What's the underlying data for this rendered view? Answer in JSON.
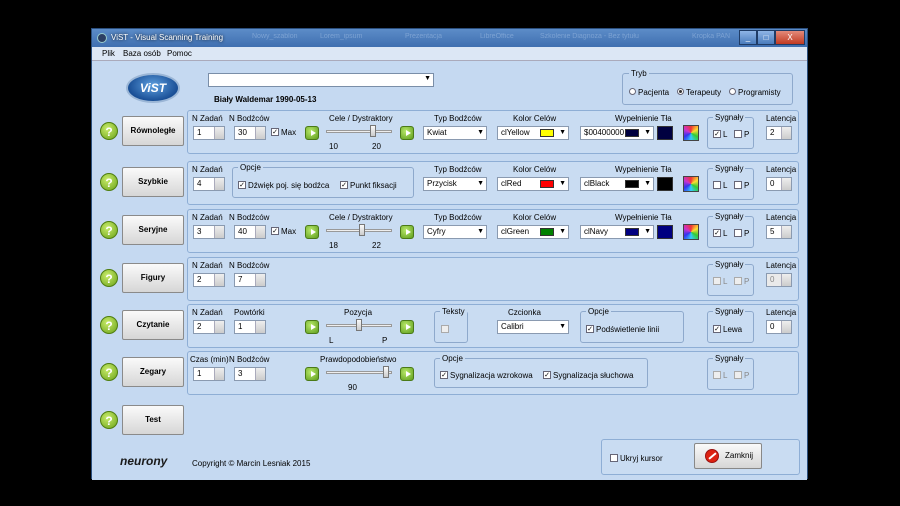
{
  "window": {
    "title": "ViST - Visual Scanning Training",
    "background_tasks": [
      "Nowy_szablon",
      "Lorem_ipsum",
      "Prezentacja",
      "LibreOffice",
      "Szkolenie Diagnoza - Bez tytułu",
      "Kropka PAN"
    ],
    "controls": {
      "minimize": "_",
      "maximize": "□",
      "close": "X"
    }
  },
  "menu": {
    "items": [
      "Plik",
      "Baza osób",
      "Pomoc"
    ]
  },
  "header": {
    "logo_text": "ViST",
    "patient_select_value": "",
    "patient_name": "Biały Waldemar 1990-05-13",
    "mode": {
      "label": "Tryb",
      "options": [
        "Pacjenta",
        "Terapeuty",
        "Programisty"
      ],
      "selected": "Terapeuty"
    }
  },
  "tasks": {
    "rownolegle": {
      "label": "Równoległe",
      "n_zadan_label": "N Zadań",
      "n_zadan": "1",
      "n_bodzcow_label": "N Bodźców",
      "n_bodzcow": "30",
      "max_label": "Max",
      "max_checked": true,
      "cele_label": "Cele / Dystraktory",
      "slider_min": "10",
      "slider_max": "20",
      "slider_value": 0.72,
      "typ_label": "Typ Bodźców",
      "typ_value": "Kwiat",
      "kolor_label": "Kolor Celów",
      "kolor_value": "clYellow",
      "kolor_hex": "#ffff00",
      "wypelnienie_label": "Wypełnienie Tła",
      "wypelnienie_value": "$00400000",
      "wypelnienie_hex": "#000040",
      "sygnaly_label": "Sygnały",
      "sygnal_l": "L",
      "sygnal_p": "P",
      "l_checked": true,
      "p_checked": false,
      "latencja_label": "Latencja",
      "latencja": "2"
    },
    "szybkie": {
      "label": "Szybkie",
      "n_zadan_label": "N Zadań",
      "n_zadan": "4",
      "opcje_label": "Opcje",
      "dzwiek_label": "Dźwięk poj. się bodźca",
      "punkt_label": "Punkt fiksacji",
      "typ_label": "Typ Bodźców",
      "typ_value": "Przycisk",
      "kolor_label": "Kolor Celów",
      "kolor_value": "clRed",
      "kolor_hex": "#ff0000",
      "wypelnienie_label": "Wypełnienie Tła",
      "wypelnienie_value": "clBlack",
      "wypelnienie_hex": "#000000",
      "sygnaly_label": "Sygnały",
      "sygnal_l": "L",
      "sygnal_p": "P",
      "latencja_label": "Latencja",
      "latencja": "0"
    },
    "seryjne": {
      "label": "Seryjne",
      "n_zadan_label": "N Zadań",
      "n_zadan": "3",
      "n_bodzcow_label": "N Bodźców",
      "n_bodzcow": "40",
      "max_label": "Max",
      "cele_label": "Cele / Dystraktory",
      "slider_min": "18",
      "slider_max": "22",
      "slider_value": 0.55,
      "typ_label": "Typ Bodźców",
      "typ_value": "Cyfry",
      "kolor_label": "Kolor Celów",
      "kolor_value": "clGreen",
      "kolor_hex": "#008000",
      "wypelnienie_label": "Wypełnienie Tła",
      "wypelnienie_value": "clNavy",
      "wypelnienie_hex": "#000080",
      "sygnaly_label": "Sygnały",
      "sygnal_l": "L",
      "sygnal_p": "P",
      "latencja_label": "Latencja",
      "latencja": "5"
    },
    "figury": {
      "label": "Figury",
      "n_zadan_label": "N Zadań",
      "n_zadan": "2",
      "n_bodzcow_label": "N Bodźców",
      "n_bodzcow": "7",
      "sygnaly_label": "Sygnały",
      "sygnal_l": "L",
      "sygnal_p": "P",
      "latencja_label": "Latencja",
      "latencja": "0"
    },
    "czytanie": {
      "label": "Czytanie",
      "n_zadan_label": "N Zadań",
      "n_zadan": "2",
      "powtorki_label": "Powtórki",
      "powtorki": "1",
      "pozycja_label": "Pozycja",
      "slider_min": "L",
      "slider_max": "P",
      "slider_value": 0.5,
      "teksty_label": "Teksty",
      "czcionka_label": "Czcionka",
      "czcionka_value": "Calibri",
      "opcje_label": "Opcje",
      "podswietlenie_label": "Podświetlenie linii",
      "sygnaly_label": "Sygnały",
      "lewa_label": "Lewa",
      "latencja_label": "Latencja",
      "latencja": "0"
    },
    "zegary": {
      "label": "Zegary",
      "czas_label": "Czas (min)",
      "czas": "1",
      "n_bodzcow_label": "N Bodźców",
      "n_bodzcow": "3",
      "prawdopodobienstwo_label": "Prawdopodobieństwo",
      "slider_value_label": "90",
      "slider_value": 0.9,
      "opcje_label": "Opcje",
      "wzrokowa_label": "Sygnalizacja wzrokowa",
      "sluchowa_label": "Sygnalizacja słuchowa",
      "sygnaly_label": "Sygnały",
      "sygnal_l": "L",
      "sygnal_p": "P"
    },
    "test": {
      "label": "Test"
    }
  },
  "footer": {
    "logo_text": "neurony",
    "copyright": "Copyright © Marcin Lesniak 2015",
    "ukryj_kursor_label": "Ukryj kursor",
    "zamknij_label": "Zamknij"
  }
}
